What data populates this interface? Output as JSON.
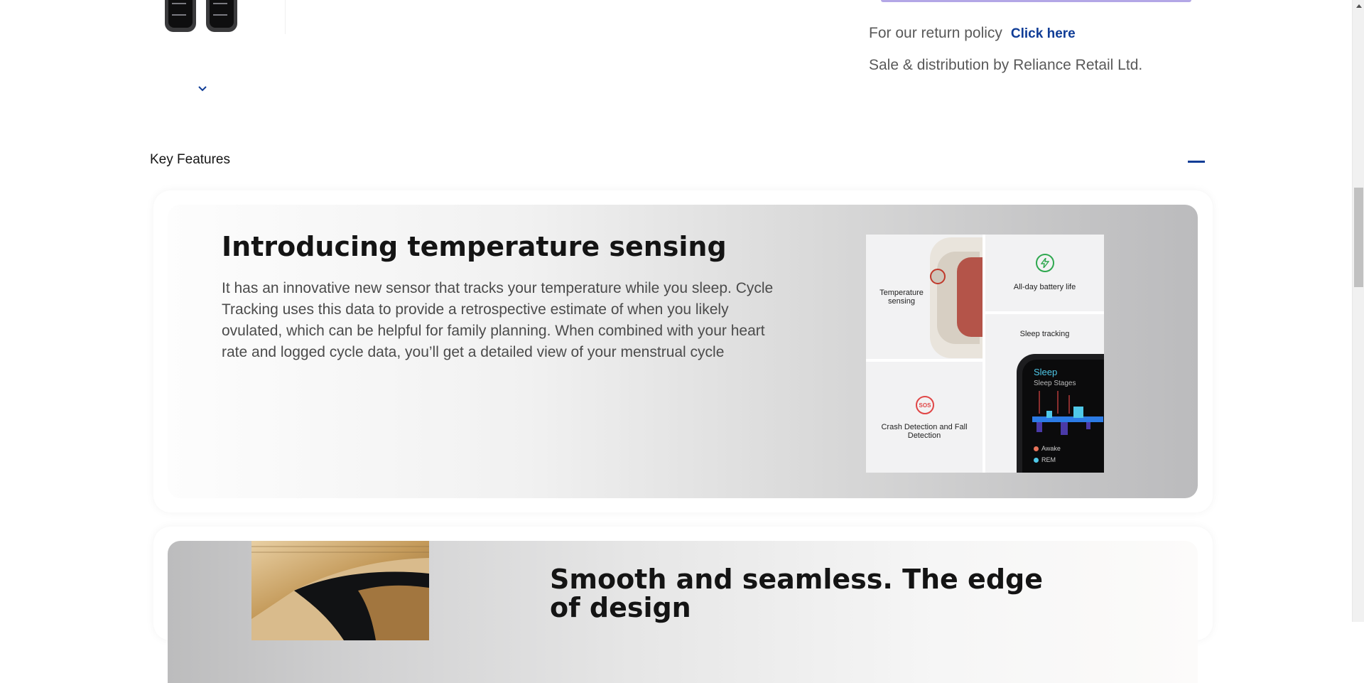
{
  "gallery": {
    "thumbnail_alt": "Apple Watch thumbnails",
    "scroll_down_icon": "chevron-down-icon"
  },
  "purchase_info": {
    "return_policy_text": "For our return policy",
    "return_policy_link": "Click here",
    "sale_distribution": "Sale & distribution by Reliance Retail Ltd."
  },
  "key_features": {
    "section_title": "Key Features",
    "collapse_icon": "minus-icon",
    "features": [
      {
        "heading": "Introducing temperature sensing",
        "body": "It has an innovative new sensor that tracks your temperature while you sleep. Cycle Tracking uses this data to provide a retrospective estimate of when you likely ovulated, which can be helpful for family planning. When combined with your heart rate and logged cycle data, you’ll get a detailed view of your menstrual cycle",
        "collage": {
          "temperature": "Temperature sensing",
          "battery": "All-day battery life",
          "sleep": "Sleep tracking",
          "crash": "Crash Detection and Fall Detection",
          "sos_badge": "SOS",
          "screen_title": "Sleep",
          "screen_subtitle": "Sleep Stages",
          "legend_awake": "Awake",
          "legend_rem": "REM"
        }
      },
      {
        "heading": "Smooth and seamless. The edge of design"
      }
    ]
  },
  "colors": {
    "link": "#0f3c96",
    "accent_purple": "#b3a7e6",
    "battery_green": "#2fa84f",
    "sos_red": "#e04646",
    "sleep_cyan": "#4fc8e8"
  }
}
